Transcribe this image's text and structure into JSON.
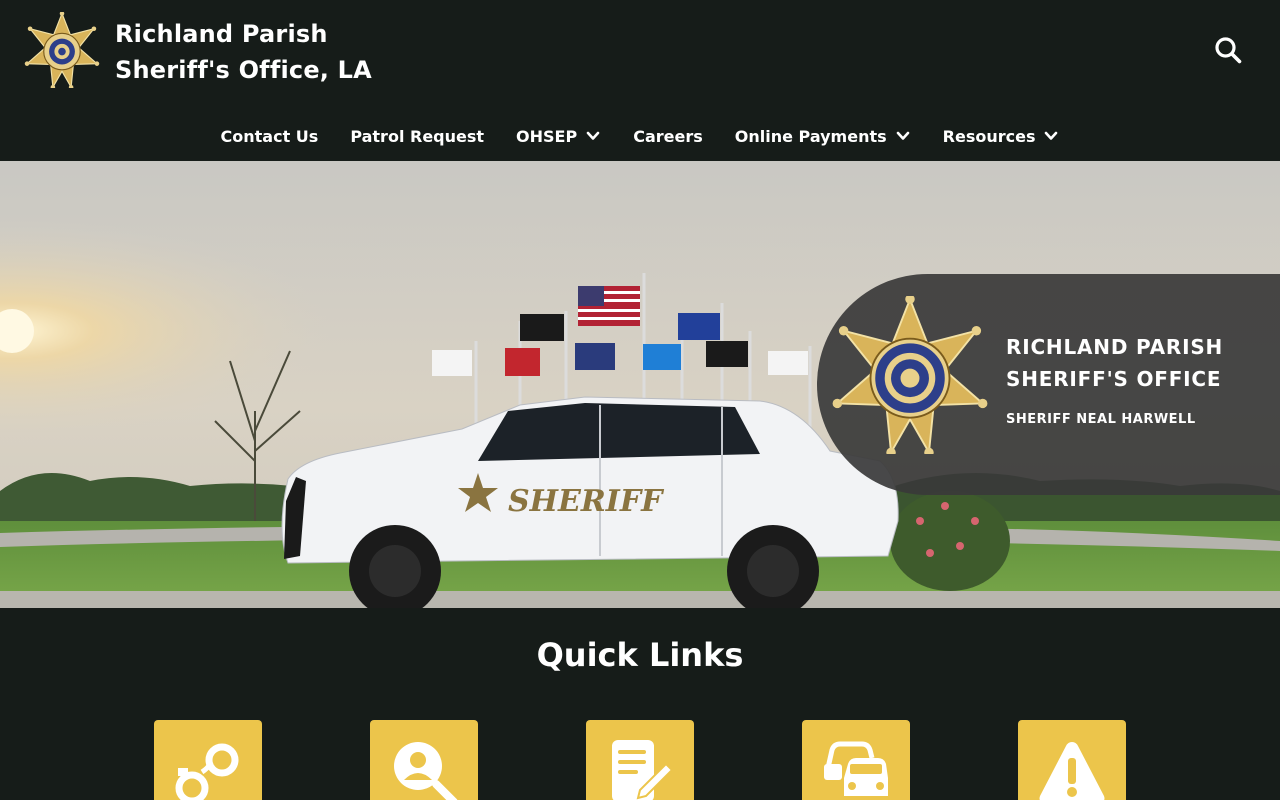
{
  "header": {
    "title_line1": "Richland Parish",
    "title_line2": "Sheriff's Office, LA",
    "logo_icon": "sheriff-star-badge",
    "search_icon": "search-icon"
  },
  "nav": {
    "items": [
      {
        "label": "Contact Us",
        "has_dropdown": false
      },
      {
        "label": "Patrol Request",
        "has_dropdown": false
      },
      {
        "label": "OHSEP",
        "has_dropdown": true
      },
      {
        "label": "Careers",
        "has_dropdown": false
      },
      {
        "label": "Online Payments",
        "has_dropdown": true
      },
      {
        "label": "Resources",
        "has_dropdown": true
      }
    ]
  },
  "hero": {
    "overlay_title_line1": "RICHLAND PARISH",
    "overlay_title_line2": "SHERIFF'S OFFICE",
    "overlay_subtitle": "SHERIFF NEAL HARWELL",
    "vehicle_text": "SHERIFF"
  },
  "quick_links": {
    "title": "Quick Links",
    "tiles": [
      {
        "icon": "handcuffs-icon"
      },
      {
        "icon": "search-person-icon"
      },
      {
        "icon": "document-edit-icon"
      },
      {
        "icon": "traffic-cars-icon"
      },
      {
        "icon": "warning-icon"
      }
    ]
  },
  "colors": {
    "background": "#161c19",
    "accent": "#ecc54b",
    "overlay": "#3a3a3a"
  }
}
